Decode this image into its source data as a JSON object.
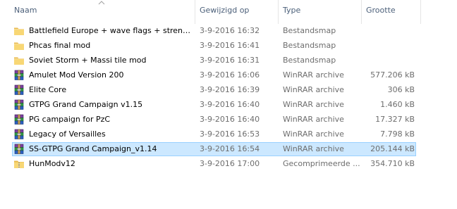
{
  "columns": {
    "name": "Naam",
    "date": "Gewijzigd op",
    "type": "Type",
    "size": "Grootte"
  },
  "files": [
    {
      "name": "Battlefield Europe + wave flags + strengt...",
      "date": "3-9-2016 16:32",
      "type": "Bestandsmap",
      "size": "",
      "icon": "folder-icon"
    },
    {
      "name": "Phcas final mod",
      "date": "3-9-2016 16:41",
      "type": "Bestandsmap",
      "size": "",
      "icon": "folder-icon"
    },
    {
      "name": "Soviet Storm + Massi tile mod",
      "date": "3-9-2016 16:31",
      "type": "Bestandsmap",
      "size": "",
      "icon": "folder-icon"
    },
    {
      "name": "Amulet Mod Version 200",
      "date": "3-9-2016 16:06",
      "type": "WinRAR archive",
      "size": "577.206 kB",
      "icon": "winrar-archive-icon"
    },
    {
      "name": "Elite Core",
      "date": "3-9-2016 16:39",
      "type": "WinRAR archive",
      "size": "306 kB",
      "icon": "winrar-archive-icon"
    },
    {
      "name": "GTPG Grand Campaign v1.15",
      "date": "3-9-2016 16:40",
      "type": "WinRAR archive",
      "size": "1.460 kB",
      "icon": "winrar-archive-icon"
    },
    {
      "name": "PG campaign for PzC",
      "date": "3-9-2016 16:40",
      "type": "WinRAR archive",
      "size": "17.327 kB",
      "icon": "winrar-archive-icon"
    },
    {
      "name": "Legacy of Versailles",
      "date": "3-9-2016 16:53",
      "type": "WinRAR archive",
      "size": "7.798 kB",
      "icon": "winrar-archive-icon"
    },
    {
      "name": "SS-GTPG Grand Campaign_v1.14",
      "date": "3-9-2016 16:54",
      "type": "WinRAR archive",
      "size": "205.144 kB",
      "icon": "winrar-archive-icon",
      "selected": true
    },
    {
      "name": "HunModv12",
      "date": "3-9-2016 17:00",
      "type": "Gecomprimeerde ...",
      "size": "354.710 kB",
      "icon": "zip-folder-icon"
    }
  ],
  "colors": {
    "selection_bg": "#cce8ff",
    "selection_border": "#99d1ff",
    "header_text": "#4c607a",
    "detail_text": "#6d6d6d",
    "folder_yellow": "#f8d775"
  }
}
